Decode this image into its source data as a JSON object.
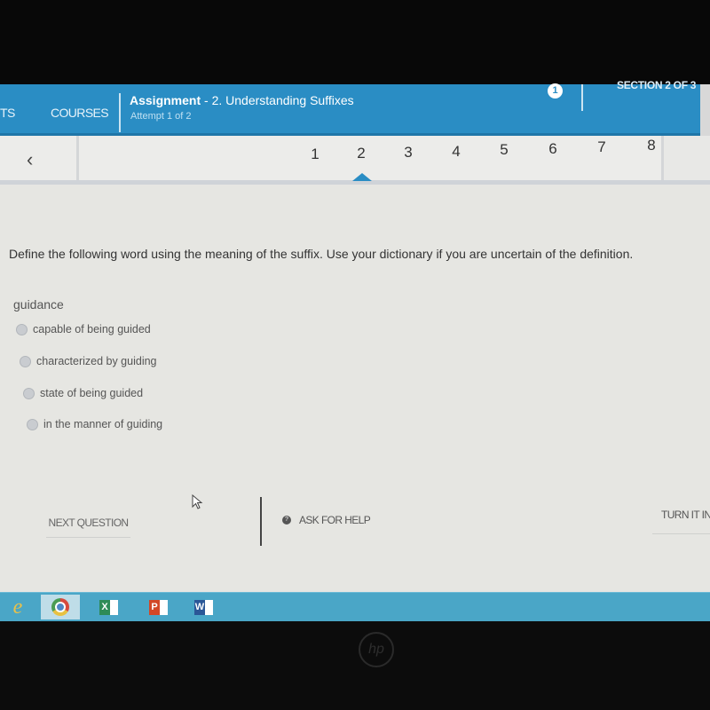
{
  "header": {
    "nav_partial": "TS",
    "nav_courses": "COURSES",
    "assignment_label": "Assignment",
    "assignment_title": " - 2. Understanding Suffixes",
    "attempt": "Attempt 1 of 2",
    "info_badge": "1",
    "section": "SECTION 2 OF 3"
  },
  "pager": {
    "back_icon": "‹",
    "pages": [
      "1",
      "2",
      "3",
      "4",
      "5",
      "6",
      "7",
      "8"
    ],
    "active_page": "2",
    "accent_color": "#2a8dc4"
  },
  "question": {
    "prompt": "Define the following word using the meaning of the suffix. Use your dictionary if you are uncertain of the definition.",
    "word": "guidance",
    "options": [
      "capable of being guided",
      "characterized by guiding",
      "state of being guided",
      "in the manner of guiding"
    ]
  },
  "footer": {
    "next_question": "NEXT QUESTION",
    "ask_for_help": "ASK FOR HELP",
    "turn_it_in": "TURN IT IN"
  },
  "taskbar": {
    "apps": [
      "internet-explorer",
      "chrome",
      "excel",
      "powerpoint",
      "word"
    ],
    "excel_letter": "X",
    "ppt_letter": "P",
    "word_letter": "W"
  },
  "bezel": {
    "logo": "hp"
  }
}
